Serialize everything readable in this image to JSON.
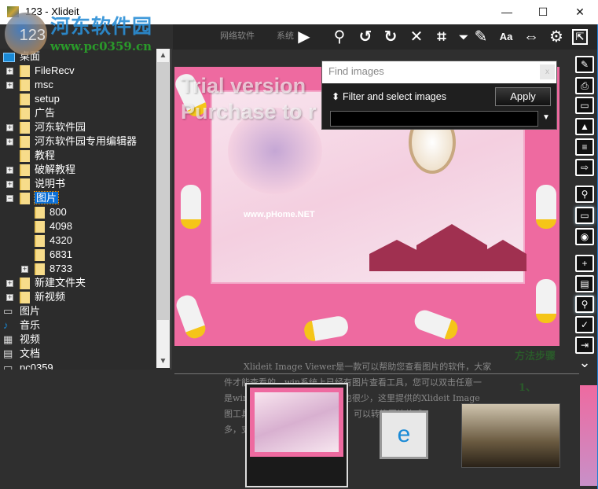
{
  "window": {
    "title": "123 - Xlideit",
    "controls": {
      "minimize": "—",
      "maximize": "☐",
      "close": "✕"
    }
  },
  "watermark": {
    "site_name": "河东软件园",
    "url": "www.pc0359.cn",
    "logo_text": "123"
  },
  "background_page": {
    "tabs": [
      "网络软件",
      "系统"
    ],
    "lines": [
      "Xlideit Image Viewer是一款可以帮助您查看图片的软件，大家",
      "件才能查看的，win系统上已经有图片查看工具，您可以双击任意一",
      "是win的看图功能很简单，功能也很少，这里提供的Xlideit Image",
      "图工具，可以批量打开图片查看，可以转换图片格式",
      "多，支持更多操作！"
    ],
    "side": [
      "方法步骤",
      "1、"
    ]
  },
  "toolbar": {
    "items": [
      {
        "name": "play",
        "glyph": "▶"
      },
      {
        "name": "search",
        "glyph": "⚲"
      },
      {
        "name": "rotate-left",
        "glyph": "↺"
      },
      {
        "name": "rotate-right",
        "glyph": "↻"
      },
      {
        "name": "close",
        "glyph": "✕"
      },
      {
        "name": "crop",
        "glyph": "⌗"
      },
      {
        "name": "dropdown",
        "glyph": "⏷"
      },
      {
        "name": "edit",
        "glyph": "✎"
      },
      {
        "name": "font-size",
        "glyph": "Aa"
      },
      {
        "name": "fit",
        "glyph": "⇔"
      },
      {
        "name": "settings",
        "glyph": "⚙"
      },
      {
        "name": "fullscreen",
        "glyph": "⇱"
      }
    ]
  },
  "tree": {
    "root": "桌面",
    "items": [
      {
        "label": "FileRecv",
        "expander": "+",
        "level": 1
      },
      {
        "label": "msc",
        "expander": "+",
        "level": 1
      },
      {
        "label": "setup",
        "expander": "",
        "level": 1
      },
      {
        "label": "广告",
        "expander": "",
        "level": 1
      },
      {
        "label": "河东软件园",
        "expander": "+",
        "level": 1
      },
      {
        "label": "河东软件园专用编辑器",
        "expander": "+",
        "level": 1
      },
      {
        "label": "教程",
        "expander": "",
        "level": 1
      },
      {
        "label": "破解教程",
        "expander": "+",
        "level": 1
      },
      {
        "label": "说明书",
        "expander": "+",
        "level": 1
      },
      {
        "label": "图片",
        "expander": "−",
        "level": 1,
        "selected": true
      },
      {
        "label": "800",
        "expander": "",
        "level": 2
      },
      {
        "label": "4098",
        "expander": "",
        "level": 2
      },
      {
        "label": "4320",
        "expander": "",
        "level": 2
      },
      {
        "label": "6831",
        "expander": "",
        "level": 2
      },
      {
        "label": "8733",
        "expander": "+",
        "level": 2
      },
      {
        "label": "新建文件夹",
        "expander": "+",
        "level": 1
      },
      {
        "label": "新视频",
        "expander": "+",
        "level": 1
      }
    ],
    "libraries": [
      "图片",
      "音乐",
      "视频",
      "文档",
      "pc0359"
    ]
  },
  "viewer": {
    "watermark_lines": [
      "Trial version",
      "Purchase to r"
    ],
    "image_text": "www.pHome.NET"
  },
  "find_dialog": {
    "title": "Find images",
    "close": "x",
    "filter_label": "Filter and select images",
    "apply": "Apply",
    "input_value": ""
  },
  "right_toolbar": [
    "edit-note",
    "print",
    "printer-alt",
    "image",
    "list",
    "folder-export",
    "zoom-photo",
    "folder",
    "camera",
    "folder-add",
    "clipboard-add",
    "search-zoom",
    "checkbox",
    "exit",
    "chevron-down"
  ],
  "accent": "#0a6fd6"
}
